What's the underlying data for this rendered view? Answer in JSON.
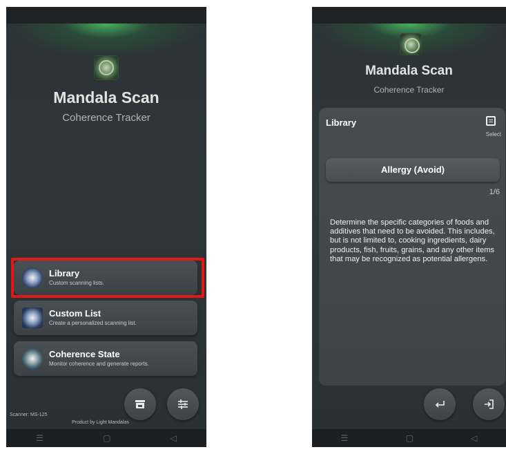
{
  "left": {
    "title": "Mandala Scan",
    "subtitle": "Coherence Tracker",
    "menu": [
      {
        "title": "Library",
        "subtitle": "Custom scanning lists."
      },
      {
        "title": "Custom List",
        "subtitle": "Create a personalized scanning list."
      },
      {
        "title": "Coherence State",
        "subtitle": "Monitor coherence and generate reports."
      }
    ],
    "scanner": "Scanner: MS-125",
    "product": "Product by Light Mandalas",
    "icons": {
      "store": "store-icon",
      "settings": "tune-icon"
    }
  },
  "right": {
    "title": "Mandala Scan",
    "subtitle": "Coherence Tracker",
    "panel": {
      "title": "Library",
      "select_label": "Select",
      "item": "Allergy (Avoid)",
      "counter": "1/6",
      "description": "Determine the specific categories of foods and additives that need to be avoided. This includes, but is not limited to, cooking ingredients, dairy products, fish, fruits, grains, and any other items that may be recognized as potential allergens."
    },
    "icons": {
      "back": "back-arrow-icon",
      "enter": "login-arrow-icon"
    }
  },
  "navbar": {
    "menu_glyph": "☰",
    "home_glyph": "▢",
    "back_glyph": "◁"
  },
  "colors": {
    "highlight": "#e51616",
    "glow": "#50dc6e",
    "background": "#2b3134"
  }
}
